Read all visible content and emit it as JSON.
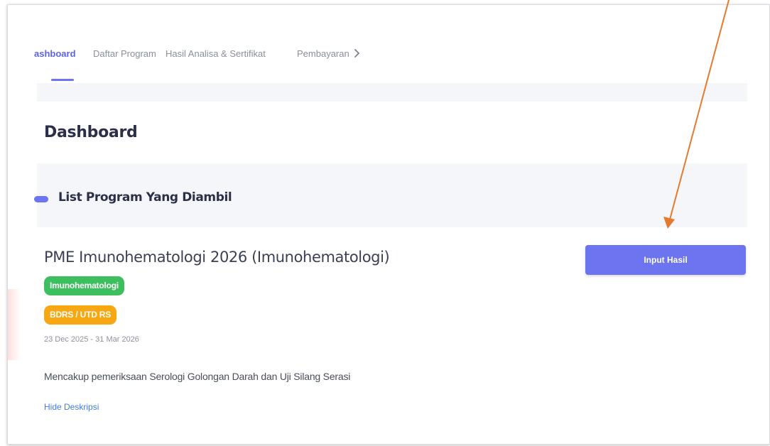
{
  "nav": {
    "tabs": [
      "ashboard",
      "Daftar Program",
      "Hasil Analisa & Sertifikat",
      "Pembayaran"
    ]
  },
  "page": {
    "title": "Dashboard"
  },
  "section": {
    "title": "List Program Yang Diambil"
  },
  "program": {
    "title": "PME Imunohematologi 2026 (Imunohematologi)",
    "category_badge": "Imunohematologi",
    "type_badge": "BDRS / UTD RS",
    "date_range": "23 Dec 2025 - 31 Mar 2026",
    "description": "Mencakup pemeriksaan Serologi Golongan Darah dan Uji Silang Serasi",
    "hide_description_label": "Hide Deskripsi",
    "input_button_label": "Input Hasil"
  },
  "colors": {
    "accent": "#6c74ef",
    "badge_green": "#3dbf5f",
    "badge_orange": "#f7a711",
    "annotation_arrow": "#e57a2e"
  },
  "icons": {
    "tab_scroll": "chevron-right-icon",
    "annotation": "arrow-icon"
  }
}
